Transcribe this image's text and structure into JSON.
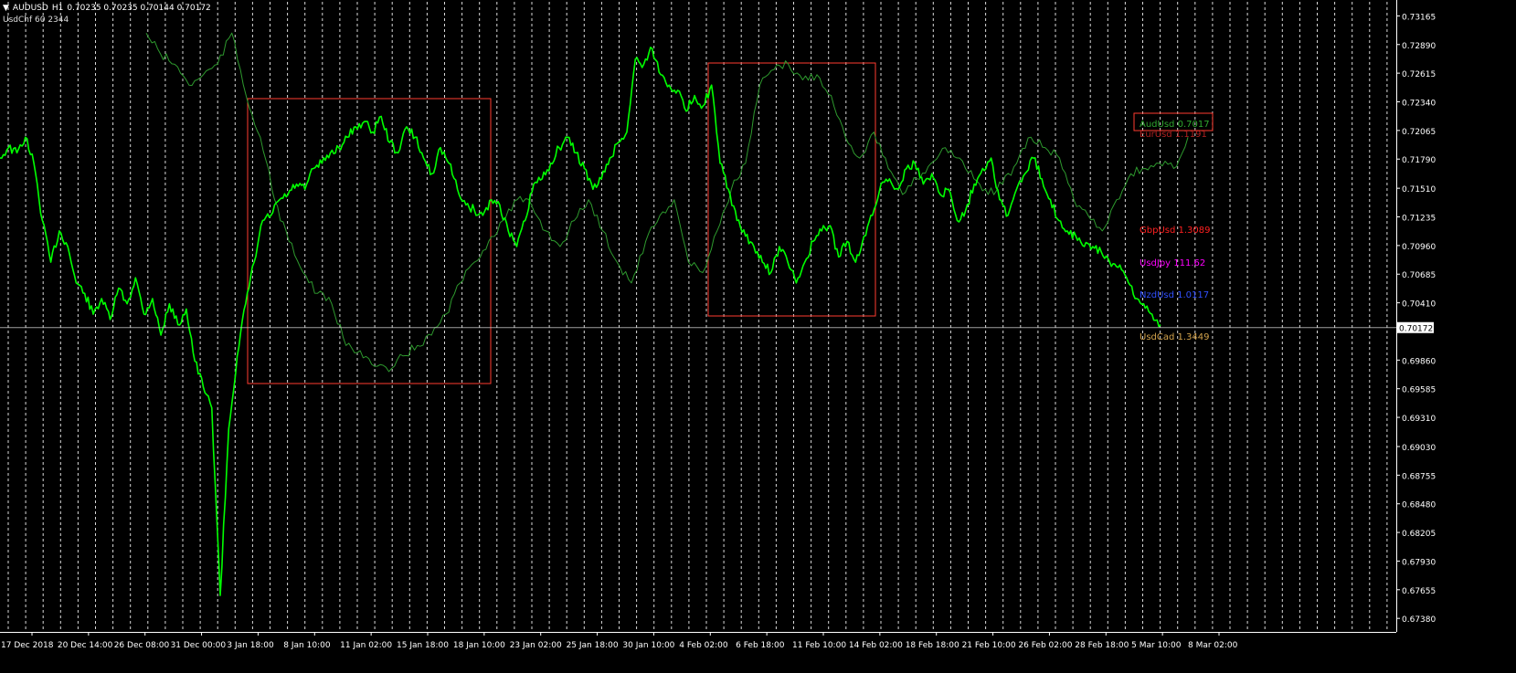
{
  "header": {
    "menu_glyph": "▼",
    "symbol": "AUDUSD",
    "timeframe": "H1",
    "ohlc": "0.70235 0.70235 0.70144 0.70172",
    "indicator": "UsdChf 60 2344"
  },
  "colors": {
    "background": "#000000",
    "grid": "#ffffff",
    "price_line": "#00ff00",
    "overlay_line": "#2e9a2e",
    "box": "#ff3b30",
    "axis_text": "#ffffff"
  },
  "chart_data": {
    "type": "line",
    "grid": true,
    "current_price": "0.70172",
    "price_axis_labels": [
      "0.73165",
      "0.72890",
      "0.72615",
      "0.72340",
      "0.72065",
      "0.71790",
      "0.71510",
      "0.71235",
      "0.70960",
      "0.70685",
      "0.70410",
      "0.69860",
      "0.69585",
      "0.69310",
      "0.69030",
      "0.68755",
      "0.68480",
      "0.68205",
      "0.67930",
      "0.67655",
      "0.67380"
    ],
    "time_axis_labels": [
      "17 Dec 2018",
      "20 Dec 14:00",
      "26 Dec 08:00",
      "31 Dec 00:00",
      "3 Jan 18:00",
      "8 Jan 10:00",
      "11 Jan 02:00",
      "15 Jan 18:00",
      "18 Jan 10:00",
      "23 Jan 02:00",
      "25 Jan 18:00",
      "30 Jan 10:00",
      "4 Feb 02:00",
      "6 Feb 18:00",
      "11 Feb 10:00",
      "14 Feb 02:00",
      "18 Feb 18:00",
      "21 Feb 10:00",
      "26 Feb 02:00",
      "28 Feb 18:00",
      "5 Mar 10:00",
      "8 Mar 02:00"
    ],
    "series": [
      {
        "name": "AUDUSD H1",
        "values": [
          0.718,
          0.719,
          0.7185,
          0.72,
          0.7175,
          0.712,
          0.708,
          0.711,
          0.7095,
          0.706,
          0.705,
          0.703,
          0.7045,
          0.7025,
          0.7055,
          0.704,
          0.7065,
          0.703,
          0.7045,
          0.701,
          0.704,
          0.702,
          0.7035,
          0.6985,
          0.696,
          0.694,
          0.676,
          0.692,
          0.699,
          0.704,
          0.708,
          0.712,
          0.7125,
          0.714,
          0.7145,
          0.7155,
          0.715,
          0.717,
          0.7175,
          0.7185,
          0.719,
          0.72,
          0.721,
          0.7215,
          0.7205,
          0.722,
          0.7195,
          0.7185,
          0.721,
          0.72,
          0.718,
          0.7165,
          0.719,
          0.7175,
          0.715,
          0.7135,
          0.713,
          0.7125,
          0.714,
          0.7135,
          0.711,
          0.7095,
          0.712,
          0.7155,
          0.716,
          0.7175,
          0.719,
          0.72,
          0.7185,
          0.717,
          0.715,
          0.716,
          0.718,
          0.7195,
          0.7205,
          0.7275,
          0.727,
          0.7285,
          0.726,
          0.725,
          0.7245,
          0.7225,
          0.724,
          0.723,
          0.725,
          0.7175,
          0.715,
          0.712,
          0.7105,
          0.7095,
          0.708,
          0.707,
          0.7095,
          0.708,
          0.706,
          0.708,
          0.71,
          0.711,
          0.7115,
          0.7085,
          0.71,
          0.708,
          0.7105,
          0.7125,
          0.7155,
          0.716,
          0.715,
          0.717,
          0.7175,
          0.7155,
          0.7165,
          0.7145,
          0.715,
          0.712,
          0.713,
          0.7155,
          0.717,
          0.718,
          0.714,
          0.7125,
          0.715,
          0.7165,
          0.718,
          0.716,
          0.714,
          0.712,
          0.711,
          0.7105,
          0.7095,
          0.7095,
          0.709,
          0.708,
          0.7075,
          0.7065,
          0.7045,
          0.704,
          0.703,
          0.702
        ]
      },
      {
        "name": "UsdChf",
        "values": [
          0.73,
          0.728,
          0.727,
          0.725,
          0.726,
          0.727,
          0.73,
          0.724,
          0.72,
          0.714,
          0.71,
          0.707,
          0.705,
          0.704,
          0.7,
          0.6995,
          0.698,
          0.6975,
          0.699,
          0.7,
          0.701,
          0.703,
          0.706,
          0.708,
          0.71,
          0.712,
          0.714,
          0.7135,
          0.711,
          0.7095,
          0.712,
          0.714,
          0.711,
          0.708,
          0.706,
          0.71,
          0.7125,
          0.714,
          0.708,
          0.707,
          0.711,
          0.715,
          0.7175,
          0.725,
          0.7265,
          0.727,
          0.7255,
          0.726,
          0.724,
          0.72,
          0.718,
          0.7205,
          0.717,
          0.7145,
          0.716,
          0.7175,
          0.719,
          0.718,
          0.716,
          0.7145,
          0.7155,
          0.7175,
          0.72,
          0.719,
          0.718,
          0.714,
          0.7125,
          0.711,
          0.714,
          0.7165,
          0.717,
          0.7175,
          0.717,
          0.72
        ]
      }
    ],
    "boxes": [
      "Jan box",
      "Feb box",
      "label box"
    ]
  },
  "labels": [
    {
      "text": "AudUsd 0.7017",
      "color": "#2fa82f"
    },
    {
      "text": "EurUsd 1.1191",
      "color": "#b02020"
    },
    {
      "text": "GbpUsd 1.3089",
      "color": "#ff2020"
    },
    {
      "text": "UsdJpy 111.62",
      "color": "#ff00ff"
    },
    {
      "text": "NzdUsd 1.0117",
      "color": "#3050ff"
    },
    {
      "text": "UsdCad 1.3449",
      "color": "#d2a24c"
    }
  ]
}
